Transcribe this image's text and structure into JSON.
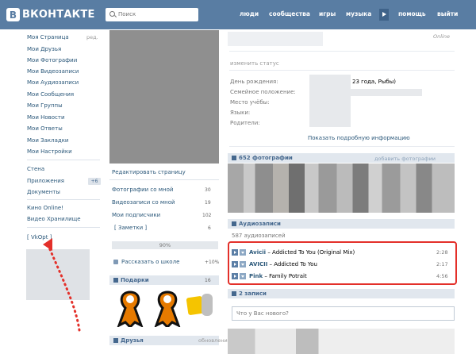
{
  "header": {
    "logo_text": "ВКОНТАКТЕ",
    "logo_letter": "В",
    "search_placeholder": "Поиск",
    "nav": [
      "люди",
      "сообщества",
      "игры",
      "музыка",
      "помощь",
      "выйти"
    ]
  },
  "left_menu": {
    "items": [
      "Моя Страница",
      "Мои Друзья",
      "Мои Фотографии",
      "Мои Видеозаписи",
      "Мои Аудиозаписи",
      "Мои Сообщения",
      "Мои Группы",
      "Мои Новости",
      "Мои Ответы",
      "Мои Закладки",
      "Мои Настройки"
    ],
    "edit_label": "ред.",
    "items2": [
      "Стена",
      "Приложения",
      "Документы"
    ],
    "apps_count": "+6",
    "items3": [
      "Кино Online!",
      "Видео Хранилище"
    ],
    "vkopt": "[ VkOpt ]"
  },
  "profile": {
    "online": "Online",
    "status": "изменить статус",
    "info_labels": [
      "День рождения:",
      "Семейное положение:",
      "Место учёбы:",
      "Языки:",
      "Родители:"
    ],
    "birthday_tail": "23 года, Рыбы)",
    "show_more": "Показать подробную информацию",
    "edit_page": "Редактировать страницу",
    "stats": [
      {
        "label": "Фотографии со мной",
        "count": "30"
      },
      {
        "label": "Видеозаписи со мной",
        "count": "19"
      },
      {
        "label": "Мои подписчики",
        "count": "102"
      },
      {
        "label": "[ Заметки ]",
        "count": "6"
      }
    ],
    "progress": "90%",
    "progress_value": 0.9,
    "school": "Рассказать о школе",
    "school_pct": "+10%",
    "gifts_title": "Подарки",
    "gifts_count": "16",
    "friends_title": "Друзья",
    "friends_updates": "обновления"
  },
  "photos": {
    "title": "652 фотографии",
    "add": "добавить фотографии"
  },
  "audio": {
    "title": "Аудиозаписи",
    "count": "587 аудиозаписей",
    "tracks": [
      {
        "artist": "Avicii",
        "title": "Addicted To You (Original Mix)",
        "duration": "2:28"
      },
      {
        "artist": "AVICII",
        "title": "Addicted To You",
        "duration": "2:17"
      },
      {
        "artist": "Pink",
        "title": "Family Potrait",
        "duration": "4:56"
      }
    ],
    "dash": " – "
  },
  "wall": {
    "title": "2 записи",
    "placeholder": "Что у Вас нового?"
  },
  "colors": {
    "header": "#597da3",
    "link": "#2b587a",
    "highlight": "#e3302a",
    "arrow": "#e3302a"
  }
}
